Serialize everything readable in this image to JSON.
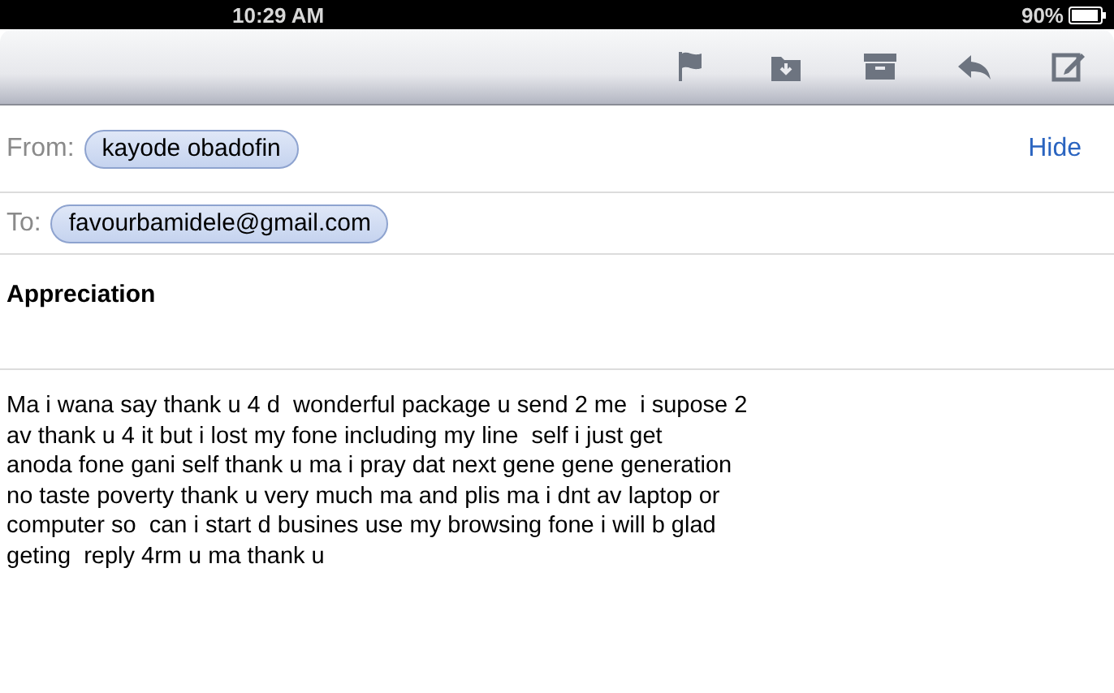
{
  "status_bar": {
    "time": "10:29 AM",
    "battery": "90%"
  },
  "toolbar": {
    "buttons": [
      {
        "kind": "flag"
      },
      {
        "kind": "move"
      },
      {
        "kind": "archive"
      },
      {
        "kind": "reply"
      },
      {
        "kind": "compose"
      }
    ]
  },
  "header": {
    "from_label": "From:",
    "from": "kayode obadofin",
    "hide": "Hide",
    "to_label": "To:",
    "to": "favourbamidele@gmail.com"
  },
  "subject": "Appreciation",
  "body": "Ma i wana say thank u 4 d  wonderful package u send 2 me  i supose 2\nav thank u 4 it but i lost my fone including my line  self i just get\nanoda fone gani self thank u ma i pray dat next gene gene generation\nno taste poverty thank u very much ma and plis ma i dnt av laptop or\ncomputer so  can i start d busines use my browsing fone i will b glad\ngeting  reply 4rm u ma thank u"
}
